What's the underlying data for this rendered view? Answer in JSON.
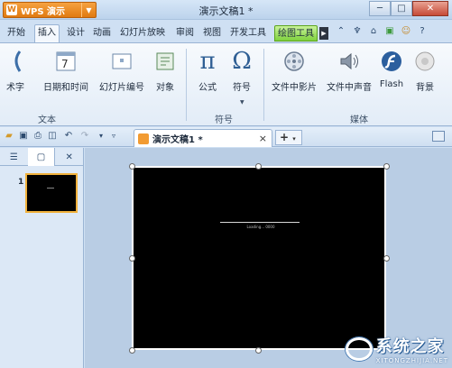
{
  "app_button": {
    "label": "WPS 演示"
  },
  "window": {
    "title": "演示文稿1 *"
  },
  "window_controls": {
    "minimize": "─",
    "maximize": "□",
    "close": "✕"
  },
  "tabs": [
    {
      "label": "开始"
    },
    {
      "label": "插入",
      "active": true
    },
    {
      "label": "设计"
    },
    {
      "label": "动画"
    },
    {
      "label": "幻灯片放映"
    },
    {
      "label": "审阅"
    },
    {
      "label": "视图"
    },
    {
      "label": "开发工具"
    },
    {
      "label": "绘图工具",
      "contextual": true
    }
  ],
  "ribbon": {
    "groups": [
      {
        "label": "文本",
        "buttons": [
          {
            "label": "术字",
            "icon": "wordart-icon"
          },
          {
            "label": "日期和时间",
            "icon": "calendar-icon"
          },
          {
            "label": "幻灯片编号",
            "icon": "slide-number-icon"
          },
          {
            "label": "对象",
            "icon": "object-icon"
          }
        ]
      },
      {
        "label": "符号",
        "buttons": [
          {
            "label": "公式",
            "icon": "pi-icon"
          },
          {
            "label": "符号",
            "icon": "omega-icon"
          }
        ]
      },
      {
        "label": "媒体",
        "buttons": [
          {
            "label": "文件中影片",
            "icon": "film-reel-icon"
          },
          {
            "label": "文件中声音",
            "icon": "speaker-icon"
          },
          {
            "label": "Flash",
            "icon": "flash-icon"
          },
          {
            "label": "背景",
            "icon": "background-icon"
          }
        ]
      }
    ]
  },
  "document_tab": {
    "name": "演示文稿1 *",
    "close": "×"
  },
  "new_tab": {
    "label": "+",
    "caret": "▾"
  },
  "slide_pane": {
    "slides": [
      {
        "number": "1"
      }
    ],
    "close": "✕"
  },
  "slide": {
    "text": "Loading... 0000"
  },
  "watermark": {
    "cn": "系统之家",
    "en": "XITONGZHIJIA.NET"
  },
  "colors": {
    "accent": "#e07a10",
    "drawing_tab": "#7fd13d",
    "slide_bg": "#000000"
  }
}
